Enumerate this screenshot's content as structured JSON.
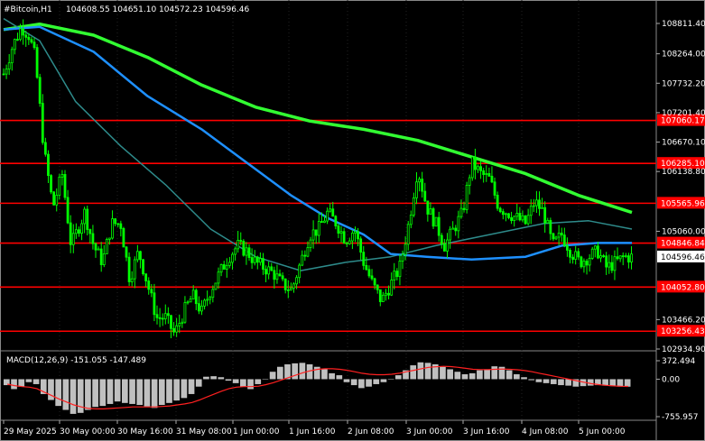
{
  "window": {
    "symbol_header": "#Bitcoin,H1",
    "ohlc_header": "104608.55 104651.10 104572.23 104596.46"
  },
  "price_axis": {
    "labels": [
      "108811.40",
      "108264.00",
      "107732.20",
      "107201.40",
      "106670.10",
      "106138.80",
      "105060.00",
      "104596.46",
      "103466.20",
      "102934.90"
    ],
    "current_price": "104596.46"
  },
  "levels": [
    {
      "label": "107060.17",
      "value": 107060.17
    },
    {
      "label": "106285.10",
      "value": 106285.1
    },
    {
      "label": "105565.96",
      "value": 105565.96
    },
    {
      "label": "104846.84",
      "value": 104846.84
    },
    {
      "label": "104052.80",
      "value": 104052.8
    },
    {
      "label": "103256.43",
      "value": 103256.43
    }
  ],
  "macd": {
    "label": "MACD(12,26,9) -151.055 -147.489",
    "axis_labels": [
      "372.494",
      "0.00",
      "-755.957"
    ]
  },
  "time_axis": {
    "labels": [
      "29 May 2025",
      "30 May 00:00",
      "30 May 16:00",
      "31 May 08:00",
      "1 Jun 00:00",
      "1 Jun 16:00",
      "2 Jun 08:00",
      "3 Jun 00:00",
      "3 Jun 16:00",
      "4 Jun 08:00",
      "5 Jun 00:00"
    ]
  },
  "colors": {
    "background": "#000000",
    "candle": "#00ff00",
    "level_line": "#ff0000",
    "ma_fast": "#1e90ff",
    "ma_mid": "#2e8b8b",
    "ma_slow": "#32ff32",
    "macd_hist": "#c0c0c0",
    "macd_signal": "#ff2020"
  },
  "chart_data": {
    "type": "candlestick",
    "title": "#Bitcoin,H1",
    "ylim": [
      102934.9,
      108811.4
    ],
    "x_labels": [
      "29 May 2025",
      "30 May 00:00",
      "30 May 16:00",
      "31 May 08:00",
      "1 Jun 00:00",
      "1 Jun 16:00",
      "2 Jun 08:00",
      "3 Jun 00:00",
      "3 Jun 16:00",
      "4 Jun 08:00",
      "5 Jun 00:00"
    ],
    "last_candle": {
      "open": 104608.55,
      "high": 104651.1,
      "low": 104572.23,
      "close": 104596.46
    },
    "horizontal_levels": [
      107060.17,
      106285.1,
      105565.96,
      104846.84,
      104052.8,
      103256.43
    ],
    "close_path": [
      [
        0,
        107900
      ],
      [
        10,
        108400
      ],
      [
        20,
        108750
      ],
      [
        28,
        108600
      ],
      [
        35,
        108200
      ],
      [
        45,
        106500
      ],
      [
        55,
        105500
      ],
      [
        65,
        106100
      ],
      [
        75,
        104800
      ],
      [
        90,
        105400
      ],
      [
        100,
        104800
      ],
      [
        110,
        104500
      ],
      [
        120,
        105200
      ],
      [
        130,
        105200
      ],
      [
        140,
        104200
      ],
      [
        150,
        104700
      ],
      [
        160,
        104100
      ],
      [
        170,
        103500
      ],
      [
        180,
        103500
      ],
      [
        190,
        103200
      ],
      [
        200,
        103600
      ],
      [
        210,
        103900
      ],
      [
        220,
        103600
      ],
      [
        230,
        104000
      ],
      [
        240,
        104300
      ],
      [
        250,
        104600
      ],
      [
        260,
        104800
      ],
      [
        270,
        104700
      ],
      [
        280,
        104500
      ],
      [
        290,
        104400
      ],
      [
        300,
        104300
      ],
      [
        310,
        104100
      ],
      [
        320,
        104000
      ],
      [
        330,
        104500
      ],
      [
        340,
        105000
      ],
      [
        350,
        105100
      ],
      [
        360,
        105400
      ],
      [
        370,
        105200
      ],
      [
        380,
        104900
      ],
      [
        390,
        105100
      ],
      [
        400,
        104500
      ],
      [
        410,
        104100
      ],
      [
        420,
        103800
      ],
      [
        430,
        104100
      ],
      [
        440,
        104400
      ],
      [
        450,
        105200
      ],
      [
        460,
        106200
      ],
      [
        470,
        105500
      ],
      [
        480,
        105200
      ],
      [
        490,
        104800
      ],
      [
        500,
        105100
      ],
      [
        510,
        105400
      ],
      [
        520,
        106300
      ],
      [
        530,
        106100
      ],
      [
        540,
        106000
      ],
      [
        550,
        105500
      ],
      [
        560,
        105400
      ],
      [
        570,
        105300
      ],
      [
        580,
        105200
      ],
      [
        590,
        105600
      ],
      [
        600,
        105400
      ],
      [
        610,
        104800
      ],
      [
        620,
        105000
      ],
      [
        630,
        104700
      ],
      [
        640,
        104500
      ],
      [
        650,
        104600
      ],
      [
        660,
        104700
      ],
      [
        670,
        104400
      ],
      [
        680,
        104500
      ],
      [
        690,
        104600
      ],
      [
        698,
        104596
      ]
    ],
    "series": [
      {
        "name": "MA slow",
        "values": [
          [
            0,
            108700
          ],
          [
            40,
            108800
          ],
          [
            100,
            108600
          ],
          [
            160,
            108200
          ],
          [
            220,
            107700
          ],
          [
            280,
            107300
          ],
          [
            340,
            107050
          ],
          [
            400,
            106900
          ],
          [
            460,
            106700
          ],
          [
            520,
            106400
          ],
          [
            580,
            106100
          ],
          [
            640,
            105700
          ],
          [
            698,
            105400
          ]
        ]
      },
      {
        "name": "MA mid",
        "values": [
          [
            0,
            108900
          ],
          [
            40,
            108500
          ],
          [
            80,
            107400
          ],
          [
            130,
            106600
          ],
          [
            180,
            105900
          ],
          [
            230,
            105100
          ],
          [
            280,
            104600
          ],
          [
            330,
            104350
          ],
          [
            380,
            104500
          ],
          [
            430,
            104600
          ],
          [
            480,
            104800
          ],
          [
            540,
            105000
          ],
          [
            600,
            105200
          ],
          [
            650,
            105250
          ],
          [
            698,
            105100
          ]
        ]
      },
      {
        "name": "MA fast",
        "values": [
          [
            0,
            108700
          ],
          [
            40,
            108750
          ],
          [
            100,
            108300
          ],
          [
            160,
            107500
          ],
          [
            220,
            106900
          ],
          [
            270,
            106300
          ],
          [
            320,
            105700
          ],
          [
            360,
            105300
          ],
          [
            400,
            105000
          ],
          [
            430,
            104650
          ],
          [
            470,
            104600
          ],
          [
            520,
            104550
          ],
          [
            580,
            104600
          ],
          [
            620,
            104800
          ],
          [
            660,
            104850
          ],
          [
            698,
            104850
          ]
        ]
      }
    ],
    "macd_histogram": [
      -120,
      -200,
      -150,
      -60,
      -100,
      -300,
      -420,
      -540,
      -620,
      -700,
      -680,
      -620,
      -560,
      -540,
      -500,
      -450,
      -480,
      -500,
      -520,
      -550,
      -580,
      -520,
      -480,
      -430,
      -380,
      -300,
      -150,
      50,
      60,
      40,
      -30,
      -80,
      -150,
      -200,
      -100,
      0,
      150,
      250,
      300,
      320,
      330,
      300,
      250,
      200,
      120,
      80,
      -60,
      -120,
      -180,
      -150,
      -100,
      -60,
      0,
      80,
      180,
      280,
      340,
      330,
      300,
      250,
      200,
      150,
      100,
      120,
      180,
      200,
      260,
      250,
      180,
      100,
      40,
      -20,
      -60,
      -80,
      -100,
      -120,
      -130,
      -150,
      -140,
      -130,
      -120,
      -130,
      -140,
      -150,
      -151
    ],
    "macd_signal": [
      -100,
      -130,
      -150,
      -160,
      -190,
      -260,
      -330,
      -400,
      -460,
      -520,
      -560,
      -590,
      -600,
      -600,
      -590,
      -580,
      -570,
      -560,
      -560,
      -560,
      -560,
      -550,
      -540,
      -520,
      -500,
      -470,
      -420,
      -360,
      -300,
      -240,
      -190,
      -160,
      -150,
      -150,
      -140,
      -110,
      -70,
      -20,
      30,
      80,
      130,
      170,
      200,
      210,
      210,
      200,
      180,
      150,
      120,
      100,
      90,
      90,
      100,
      120,
      150,
      180,
      210,
      240,
      250,
      260,
      255,
      240,
      220,
      200,
      195,
      195,
      200,
      205,
      200,
      190,
      175,
      150,
      120,
      90,
      60,
      30,
      0,
      -30,
      -60,
      -90,
      -110,
      -125,
      -135,
      -142,
      -147
    ]
  }
}
